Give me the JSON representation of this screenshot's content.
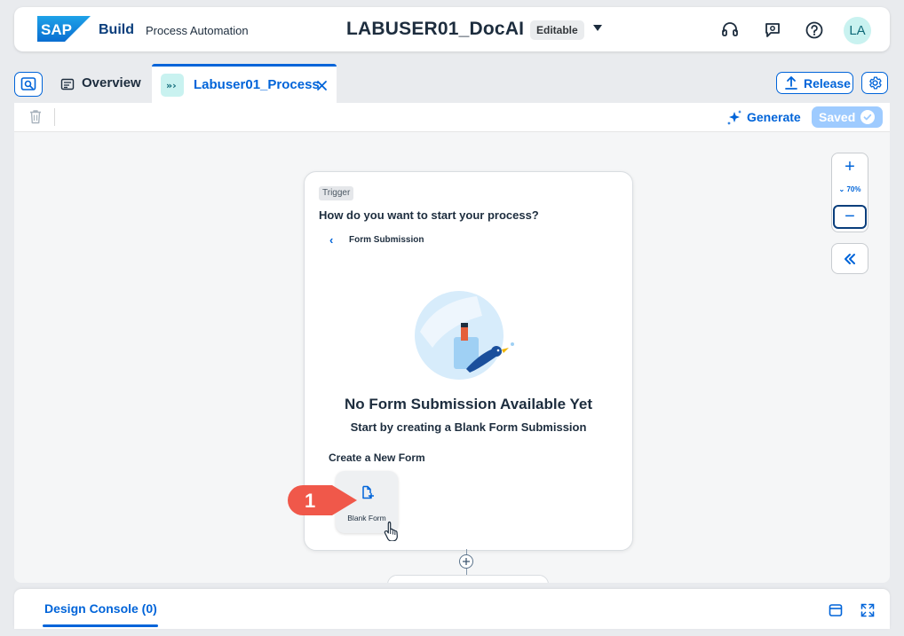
{
  "shell": {
    "logo_text": "SAP",
    "product": "Build",
    "subproduct": "Process Automation",
    "project_title": "LABUSER01_DocAI",
    "status_badge": "Editable",
    "avatar_initials": "LA"
  },
  "tabs": [
    {
      "label": "Overview",
      "icon": "overview-icon",
      "active": false
    },
    {
      "label": "Labuser01_Process",
      "icon": "process-icon",
      "active": true,
      "closable": true
    }
  ],
  "actions": {
    "release_label": "Release",
    "generate_label": "Generate",
    "saved_label": "Saved"
  },
  "zoom": {
    "level": "70%"
  },
  "trigger_card": {
    "tag": "Trigger",
    "question": "How do you want to start your process?",
    "breadcrumb": "Form Submission",
    "empty_title": "No Form Submission Available Yet",
    "empty_subtitle": "Start by creating a Blank Form Submission",
    "section_label": "Create a New Form",
    "blank_form_label": "Blank Form"
  },
  "annotation": {
    "step": "1"
  },
  "console": {
    "tab_label": "Design Console (0)"
  },
  "colors": {
    "accent": "#0064d9",
    "brand_dark": "#0a3e7c",
    "callout": "#f0584a",
    "teal": "#c9f2f0"
  }
}
